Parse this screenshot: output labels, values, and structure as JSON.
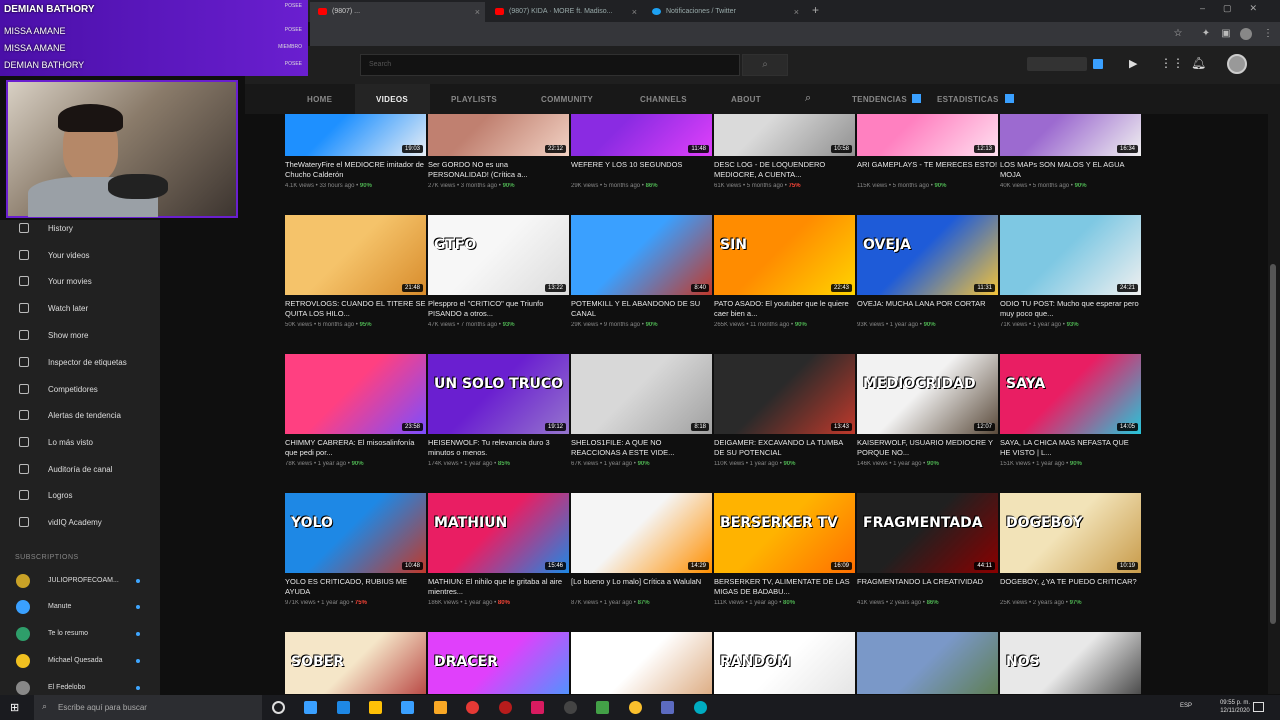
{
  "browser": {
    "tabs": [
      {
        "label": "(9807) ...",
        "color": "#ff0000"
      },
      {
        "label": "(9807) KIDA · MORE ft. Madiso...",
        "color": "#ff0000"
      },
      {
        "label": "Notificaciones / Twitter",
        "color": "#1da1f2"
      }
    ],
    "new_tab": "+"
  },
  "overlay": {
    "title": "DEMIAN BATHORY",
    "rows": [
      "MISSA AMANE",
      "MISSA AMANE",
      "DEMIAN BATHORY"
    ],
    "tags": [
      "POSEE",
      "POSEE",
      "MIEMBRO",
      "POSEE"
    ]
  },
  "header": {
    "search_placeholder": "Search",
    "search_icon": "search-icon"
  },
  "channel_tabs": [
    "HOME",
    "VIDEOS",
    "PLAYLISTS",
    "COMMUNITY",
    "CHANNELS",
    "ABOUT",
    "TENDENCIAS",
    "ESTADISTICAS"
  ],
  "active_tab": "VIDEOS",
  "sidebar": {
    "items": [
      "History",
      "Your videos",
      "Your movies",
      "Watch later",
      "Show more",
      "Inspector de etiquetas",
      "Competidores",
      "Alertas de tendencia",
      "Lo más visto",
      "Auditoría de canal",
      "Logros",
      "vidIQ Academy"
    ],
    "subscriptions_heading": "SUBSCRIPTIONS",
    "subscriptions": [
      {
        "name": "JULIOPROFECOAM...",
        "color": "#c9a227"
      },
      {
        "name": "Manute",
        "color": "#3aa0ff"
      },
      {
        "name": "Te lo resumo",
        "color": "#2e9e6a"
      },
      {
        "name": "Michael Quesada",
        "color": "#f0c020"
      },
      {
        "name": "El Fedelobo",
        "color": "#888888"
      }
    ]
  },
  "videos": [
    {
      "title": "TheWateryFire el MEDIOCRE imitador de Chucho Calderón",
      "meta": "4.1K views • 33 hours ago •",
      "score": "90%",
      "sc": "#4caf50",
      "dur": "19:03",
      "c1": "#1e90ff",
      "c2": "#e8eef5",
      "txt": "MEDIOCRE"
    },
    {
      "title": "Ser GORDO NO es una PERSONALIDAD! (Crítica a...",
      "meta": "27K views • 3 months ago •",
      "score": "90%",
      "sc": "#4caf50",
      "dur": "22:12",
      "c1": "#c08070",
      "c2": "#f2d2c4",
      "txt": ""
    },
    {
      "title": "WEFERE Y LOS 10 SEGUNDOS",
      "meta": "29K views • 5 months ago •",
      "score": "86%",
      "sc": "#4caf50",
      "dur": "11:48",
      "c1": "#8a2be2",
      "c2": "#e040fb",
      "txt": ""
    },
    {
      "title": "DESC LOG - DE LOQUENDERO MEDIOCRE, A CUENTA...",
      "meta": "61K views • 5 months ago •",
      "score": "75%",
      "sc": "#f44336",
      "dur": "10:58",
      "c1": "#dadada",
      "c2": "#909090",
      "txt": "MEDIANTE"
    },
    {
      "title": "ARI GAMEPLAYS - TE MERECES ESTO!",
      "meta": "115K views • 5 months ago •",
      "score": "90%",
      "sc": "#4caf50",
      "dur": "12:13",
      "c1": "#ff80c0",
      "c2": "#ffe0f0",
      "txt": ""
    },
    {
      "title": "LOS MAPs SON MALOS Y EL AGUA MOJA",
      "meta": "40K views • 5 months ago •",
      "score": "90%",
      "sc": "#4caf50",
      "dur": "16:34",
      "c1": "#9c6ad0",
      "c2": "#f0f0f0",
      "txt": ""
    },
    {
      "title": "RETROVLOGS: CUANDO EL TITERE SE QUITA LOS HILO...",
      "meta": "50K views • 6 months ago •",
      "score": "95%",
      "sc": "#4caf50",
      "dur": "21:48",
      "c1": "#f5c36a",
      "c2": "#d88c2c",
      "txt": ""
    },
    {
      "title": "Plesppro el \"CRITICO\" que Triunfo PISANDO a otros...",
      "meta": "47K views • 7 months ago •",
      "score": "93%",
      "sc": "#4caf50",
      "dur": "13:22",
      "c1": "#f7f7f7",
      "c2": "#dcdcdc",
      "txt": "GTFO"
    },
    {
      "title": "POTEMKILL Y EL ABANDONO DE SU CANAL",
      "meta": "29K views • 9 months ago •",
      "score": "90%",
      "sc": "#4caf50",
      "dur": "8:40",
      "c1": "#3aa0ff",
      "c2": "#c0392b",
      "txt": ""
    },
    {
      "title": "PATO ASADO: El youtuber que le quiere caer bien a...",
      "meta": "265K views • 11 months ago •",
      "score": "90%",
      "sc": "#4caf50",
      "dur": "22:43",
      "c1": "#ff8c00",
      "c2": "#ffd400",
      "txt": "SIN"
    },
    {
      "title": "OVEJA: MUCHA LANA POR CORTAR",
      "meta": "93K views • 1 year ago •",
      "score": "90%",
      "sc": "#4caf50",
      "dur": "11:31",
      "c1": "#1e5bd8",
      "c2": "#f3c33a",
      "txt": "OVEJA"
    },
    {
      "title": "ODIO TU POST: Mucho que esperar pero muy poco que...",
      "meta": "71K views • 1 year ago •",
      "score": "93%",
      "sc": "#4caf50",
      "dur": "24:21",
      "c1": "#7ec8e3",
      "c2": "#f0f0f0",
      "txt": ""
    },
    {
      "title": "CHIMMY CABRERA: El misosalinfonía que pedi por...",
      "meta": "78K views • 1 year ago •",
      "score": "90%",
      "sc": "#4caf50",
      "dur": "23:58",
      "c1": "#ff4081",
      "c2": "#7c4dff",
      "txt": ""
    },
    {
      "title": "HEISENWOLF: Tu relevancia duro 3 minutos o menos.",
      "meta": "174K views • 1 year ago •",
      "score": "85%",
      "sc": "#4caf50",
      "dur": "19:12",
      "c1": "#6a1fd0",
      "c2": "#9575cd",
      "txt": "UN SOLO TRUCO"
    },
    {
      "title": "SHELOS1FILE: A QUE NO REACCIONAS A ESTE VIDE...",
      "meta": "67K views • 1 year ago •",
      "score": "90%",
      "sc": "#4caf50",
      "dur": "8:18",
      "c1": "#d8d8d8",
      "c2": "#a0a0a0",
      "txt": ""
    },
    {
      "title": "DEIGAMER: EXCAVANDO LA TUMBA DE SU POTENCIAL",
      "meta": "110K views • 1 year ago •",
      "score": "90%",
      "sc": "#4caf50",
      "dur": "13:43",
      "c1": "#2a2a2a",
      "c2": "#c0392b",
      "txt": ""
    },
    {
      "title": "KAISERWOLF, USUARIO MEDIOCRE Y PORQUE NO...",
      "meta": "146K views • 1 year ago •",
      "score": "90%",
      "sc": "#4caf50",
      "dur": "12:07",
      "c1": "#f2f2f2",
      "c2": "#5a4a3a",
      "txt": "MEDIOCRIDAD"
    },
    {
      "title": "SAYA, LA CHICA MAS NEFASTA QUE HE VISTO | L...",
      "meta": "151K views • 1 year ago •",
      "score": "90%",
      "sc": "#4caf50",
      "dur": "14:05",
      "c1": "#e91e63",
      "c2": "#26c6da",
      "txt": "SAYA"
    },
    {
      "title": "YOLO ES CRITICADO, RUBIUS ME AYUDA",
      "meta": "971K views • 1 year ago •",
      "score": "75%",
      "sc": "#f44336",
      "dur": "10:48",
      "c1": "#1e88e5",
      "c2": "#c0392b",
      "txt": "YOLO"
    },
    {
      "title": "MATHIUN: El nihilo que le gritaba al aire mientres...",
      "meta": "186K views • 1 year ago •",
      "score": "80%",
      "sc": "#f44336",
      "dur": "15:46",
      "c1": "#e91e63",
      "c2": "#1e88e5",
      "txt": "MATHIUN"
    },
    {
      "title": "[Lo bueno y Lo malo] Crítica a WalulaN",
      "meta": "87K views • 1 year ago •",
      "score": "87%",
      "sc": "#4caf50",
      "dur": "14:29",
      "c1": "#f5f5f5",
      "c2": "#ff8f00",
      "txt": ""
    },
    {
      "title": "BERSERKER TV, ALIMENTATE DE LAS MIGAS DE BADABU...",
      "meta": "111K views • 1 year ago •",
      "score": "80%",
      "sc": "#4caf50",
      "dur": "16:09",
      "c1": "#ffb300",
      "c2": "#ff6f00",
      "txt": "BERSERKER TV"
    },
    {
      "title": "FRAGMENTANDO LA CREATIVIDAD",
      "meta": "41K views • 2 years ago •",
      "score": "86%",
      "sc": "#4caf50",
      "dur": "44:11",
      "c1": "#202020",
      "c2": "#8a0000",
      "txt": "FRAGMENTADA"
    },
    {
      "title": "DOGEBOY, ¿YA TE PUEDO CRITICAR?",
      "meta": "25K views • 2 years ago •",
      "score": "97%",
      "sc": "#4caf50",
      "dur": "10:19",
      "c1": "#f2e3b8",
      "c2": "#c89b4a",
      "txt": "DOGEBOY"
    },
    {
      "title": "",
      "meta": "",
      "score": "",
      "sc": "#4caf50",
      "dur": "",
      "c1": "#f5e6c8",
      "c2": "#b03030",
      "txt": "SOBER"
    },
    {
      "title": "",
      "meta": "",
      "score": "",
      "sc": "#4caf50",
      "dur": "",
      "c1": "#e040fb",
      "c2": "#3aa0ff",
      "txt": "DRACER"
    },
    {
      "title": "",
      "meta": "",
      "score": "",
      "sc": "#4caf50",
      "dur": "",
      "c1": "#ffffff",
      "c2": "#d8a070",
      "txt": ""
    },
    {
      "title": "",
      "meta": "",
      "score": "",
      "sc": "#4caf50",
      "dur": "",
      "c1": "#ffffff",
      "c2": "#e0e0e0",
      "txt": "RANDOM"
    },
    {
      "title": "",
      "meta": "",
      "score": "",
      "sc": "#4caf50",
      "dur": "",
      "c1": "#7a98c8",
      "c2": "#5a7a40",
      "txt": ""
    },
    {
      "title": "",
      "meta": "",
      "score": "",
      "sc": "#4caf50",
      "dur": "",
      "c1": "#e8e8e8",
      "c2": "#303030",
      "txt": "NOS"
    }
  ],
  "taskbar": {
    "search_placeholder": "Escribe aquí para buscar",
    "time": "09:55 p. m.",
    "date": "12/11/2020",
    "lang": "ESP"
  }
}
